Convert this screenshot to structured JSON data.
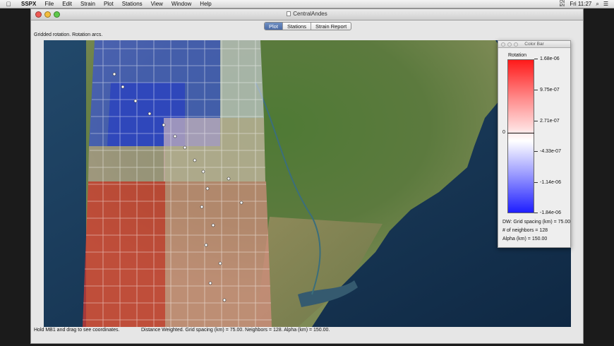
{
  "menubar": {
    "apple": "",
    "app_name": "SSPX",
    "items": [
      "File",
      "Edit",
      "Strain",
      "Plot",
      "Stations",
      "View",
      "Window",
      "Help"
    ],
    "input_flag_top": "CN",
    "input_flag_bottom": "EN",
    "clock": "Fri 11:27",
    "search_glyph": "⌕",
    "list_glyph": "☰"
  },
  "window": {
    "title": "CentralAndes"
  },
  "tabs": [
    {
      "label": "Plot",
      "active": true
    },
    {
      "label": "Stations",
      "active": false
    },
    {
      "label": "Strain Report",
      "active": false
    }
  ],
  "caption": "Gridded rotation. Rotation arcs.",
  "status": {
    "left": "Hold MB1 and drag to see coordinates.",
    "right": "Distance Weighted. Grid spacing (km) = 75.00. Neighbors = 128. Alpha (km) = 150.00."
  },
  "color_bar": {
    "title": "Color Bar",
    "variable": "Rotation",
    "ticks": [
      "1.68e-06",
      "9.75e-07",
      "2.71e-07",
      "-4.33e-07",
      "-1.14e-06",
      "-1.84e-06"
    ],
    "zero_label": "0",
    "stats": [
      "DW: Grid spacing (km) = 75.00",
      "# of neighbors = 128",
      "Alpha (km) = 150.00"
    ],
    "colors": {
      "max": "#ff1a1a",
      "mid": "#ffffff",
      "min": "#1e1eff"
    }
  }
}
